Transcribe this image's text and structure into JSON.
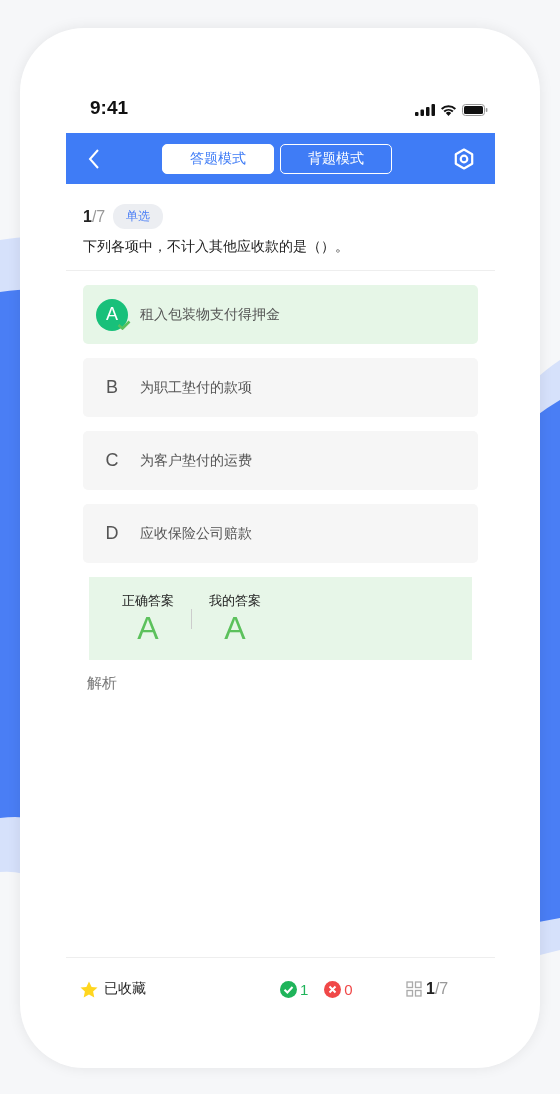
{
  "status_bar": {
    "time": "9:41"
  },
  "header": {
    "tabs": [
      {
        "label": "答题模式",
        "selected": true
      },
      {
        "label": "背题模式",
        "selected": false
      }
    ]
  },
  "question": {
    "index": "1",
    "total": "/7",
    "type": "单选",
    "text": "下列各项中，不计入其他应收款的是（）。"
  },
  "options": [
    {
      "letter": "A",
      "text": "租入包装物支付得押金",
      "selected": true
    },
    {
      "letter": "B",
      "text": "为职工垫付的款项",
      "selected": false
    },
    {
      "letter": "C",
      "text": "为客户垫付的运费",
      "selected": false
    },
    {
      "letter": "D",
      "text": "应收保险公司赔款",
      "selected": false
    }
  ],
  "answer": {
    "correct_label": "正确答案",
    "correct_value": "A",
    "my_label": "我的答案",
    "my_value": "A"
  },
  "analysis_label": "解析",
  "footer": {
    "favorite": {
      "label": "已收藏",
      "on": true
    },
    "right_count": "1",
    "wrong_count": "0",
    "progress_index": "1",
    "progress_total": "/7"
  }
}
